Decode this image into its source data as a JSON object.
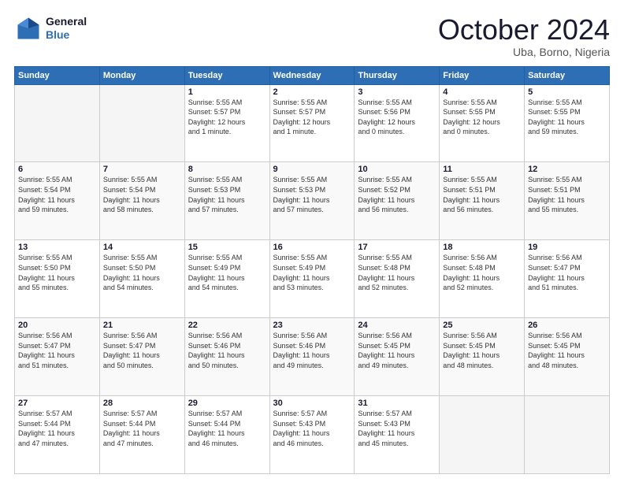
{
  "logo": {
    "line1": "General",
    "line2": "Blue"
  },
  "title": "October 2024",
  "location": "Uba, Borno, Nigeria",
  "weekdays": [
    "Sunday",
    "Monday",
    "Tuesday",
    "Wednesday",
    "Thursday",
    "Friday",
    "Saturday"
  ],
  "weeks": [
    [
      {
        "day": "",
        "info": ""
      },
      {
        "day": "",
        "info": ""
      },
      {
        "day": "1",
        "info": "Sunrise: 5:55 AM\nSunset: 5:57 PM\nDaylight: 12 hours\nand 1 minute."
      },
      {
        "day": "2",
        "info": "Sunrise: 5:55 AM\nSunset: 5:57 PM\nDaylight: 12 hours\nand 1 minute."
      },
      {
        "day": "3",
        "info": "Sunrise: 5:55 AM\nSunset: 5:56 PM\nDaylight: 12 hours\nand 0 minutes."
      },
      {
        "day": "4",
        "info": "Sunrise: 5:55 AM\nSunset: 5:55 PM\nDaylight: 12 hours\nand 0 minutes."
      },
      {
        "day": "5",
        "info": "Sunrise: 5:55 AM\nSunset: 5:55 PM\nDaylight: 11 hours\nand 59 minutes."
      }
    ],
    [
      {
        "day": "6",
        "info": "Sunrise: 5:55 AM\nSunset: 5:54 PM\nDaylight: 11 hours\nand 59 minutes."
      },
      {
        "day": "7",
        "info": "Sunrise: 5:55 AM\nSunset: 5:54 PM\nDaylight: 11 hours\nand 58 minutes."
      },
      {
        "day": "8",
        "info": "Sunrise: 5:55 AM\nSunset: 5:53 PM\nDaylight: 11 hours\nand 57 minutes."
      },
      {
        "day": "9",
        "info": "Sunrise: 5:55 AM\nSunset: 5:53 PM\nDaylight: 11 hours\nand 57 minutes."
      },
      {
        "day": "10",
        "info": "Sunrise: 5:55 AM\nSunset: 5:52 PM\nDaylight: 11 hours\nand 56 minutes."
      },
      {
        "day": "11",
        "info": "Sunrise: 5:55 AM\nSunset: 5:51 PM\nDaylight: 11 hours\nand 56 minutes."
      },
      {
        "day": "12",
        "info": "Sunrise: 5:55 AM\nSunset: 5:51 PM\nDaylight: 11 hours\nand 55 minutes."
      }
    ],
    [
      {
        "day": "13",
        "info": "Sunrise: 5:55 AM\nSunset: 5:50 PM\nDaylight: 11 hours\nand 55 minutes."
      },
      {
        "day": "14",
        "info": "Sunrise: 5:55 AM\nSunset: 5:50 PM\nDaylight: 11 hours\nand 54 minutes."
      },
      {
        "day": "15",
        "info": "Sunrise: 5:55 AM\nSunset: 5:49 PM\nDaylight: 11 hours\nand 54 minutes."
      },
      {
        "day": "16",
        "info": "Sunrise: 5:55 AM\nSunset: 5:49 PM\nDaylight: 11 hours\nand 53 minutes."
      },
      {
        "day": "17",
        "info": "Sunrise: 5:55 AM\nSunset: 5:48 PM\nDaylight: 11 hours\nand 52 minutes."
      },
      {
        "day": "18",
        "info": "Sunrise: 5:56 AM\nSunset: 5:48 PM\nDaylight: 11 hours\nand 52 minutes."
      },
      {
        "day": "19",
        "info": "Sunrise: 5:56 AM\nSunset: 5:47 PM\nDaylight: 11 hours\nand 51 minutes."
      }
    ],
    [
      {
        "day": "20",
        "info": "Sunrise: 5:56 AM\nSunset: 5:47 PM\nDaylight: 11 hours\nand 51 minutes."
      },
      {
        "day": "21",
        "info": "Sunrise: 5:56 AM\nSunset: 5:47 PM\nDaylight: 11 hours\nand 50 minutes."
      },
      {
        "day": "22",
        "info": "Sunrise: 5:56 AM\nSunset: 5:46 PM\nDaylight: 11 hours\nand 50 minutes."
      },
      {
        "day": "23",
        "info": "Sunrise: 5:56 AM\nSunset: 5:46 PM\nDaylight: 11 hours\nand 49 minutes."
      },
      {
        "day": "24",
        "info": "Sunrise: 5:56 AM\nSunset: 5:45 PM\nDaylight: 11 hours\nand 49 minutes."
      },
      {
        "day": "25",
        "info": "Sunrise: 5:56 AM\nSunset: 5:45 PM\nDaylight: 11 hours\nand 48 minutes."
      },
      {
        "day": "26",
        "info": "Sunrise: 5:56 AM\nSunset: 5:45 PM\nDaylight: 11 hours\nand 48 minutes."
      }
    ],
    [
      {
        "day": "27",
        "info": "Sunrise: 5:57 AM\nSunset: 5:44 PM\nDaylight: 11 hours\nand 47 minutes."
      },
      {
        "day": "28",
        "info": "Sunrise: 5:57 AM\nSunset: 5:44 PM\nDaylight: 11 hours\nand 47 minutes."
      },
      {
        "day": "29",
        "info": "Sunrise: 5:57 AM\nSunset: 5:44 PM\nDaylight: 11 hours\nand 46 minutes."
      },
      {
        "day": "30",
        "info": "Sunrise: 5:57 AM\nSunset: 5:43 PM\nDaylight: 11 hours\nand 46 minutes."
      },
      {
        "day": "31",
        "info": "Sunrise: 5:57 AM\nSunset: 5:43 PM\nDaylight: 11 hours\nand 45 minutes."
      },
      {
        "day": "",
        "info": ""
      },
      {
        "day": "",
        "info": ""
      }
    ]
  ]
}
